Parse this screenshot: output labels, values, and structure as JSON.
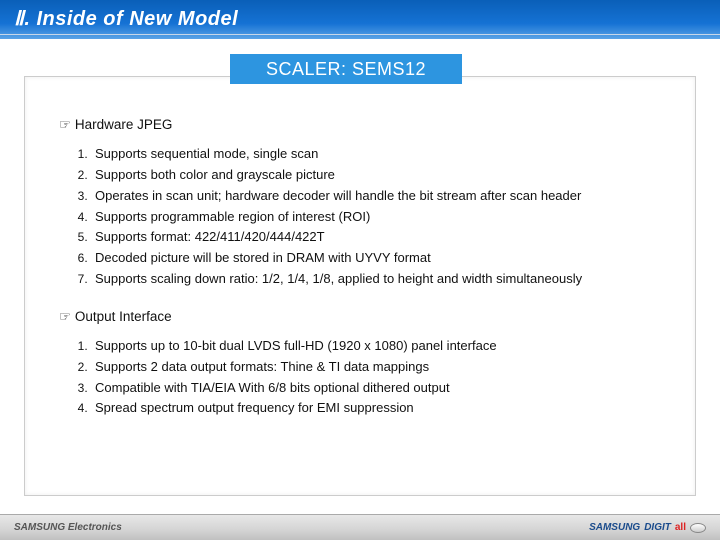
{
  "header": {
    "title": "Ⅱ. Inside of New Model"
  },
  "badge": {
    "label": "SCALER: SEMS12"
  },
  "section1": {
    "heading": "☞ Hardware JPEG",
    "items": [
      "Supports sequential mode, single scan",
      "Supports both color and grayscale picture",
      "Operates in scan unit; hardware decoder will handle the bit stream after scan header",
      "Supports programmable region of interest (ROI)",
      "Supports format: 422/411/420/444/422T",
      "Decoded picture will be stored in DRAM with UYVY format",
      "Supports scaling down ratio: 1/2, 1/4, 1/8, applied to height and width simultaneously"
    ]
  },
  "section2": {
    "heading": "☞ Output Interface",
    "items": [
      "Supports up to 10-bit dual LVDS full-HD (1920 x 1080) panel interface",
      "Supports 2 data output formats: Thine & TI data mappings",
      "Compatible with TIA/EIA  With 6/8 bits optional dithered output",
      "Spread spectrum output frequency for EMI suppression"
    ]
  },
  "footer": {
    "left": "SAMSUNG Electronics",
    "right_brand": "SAMSUNG",
    "right_digit": "DIGIT",
    "right_all": "all"
  }
}
